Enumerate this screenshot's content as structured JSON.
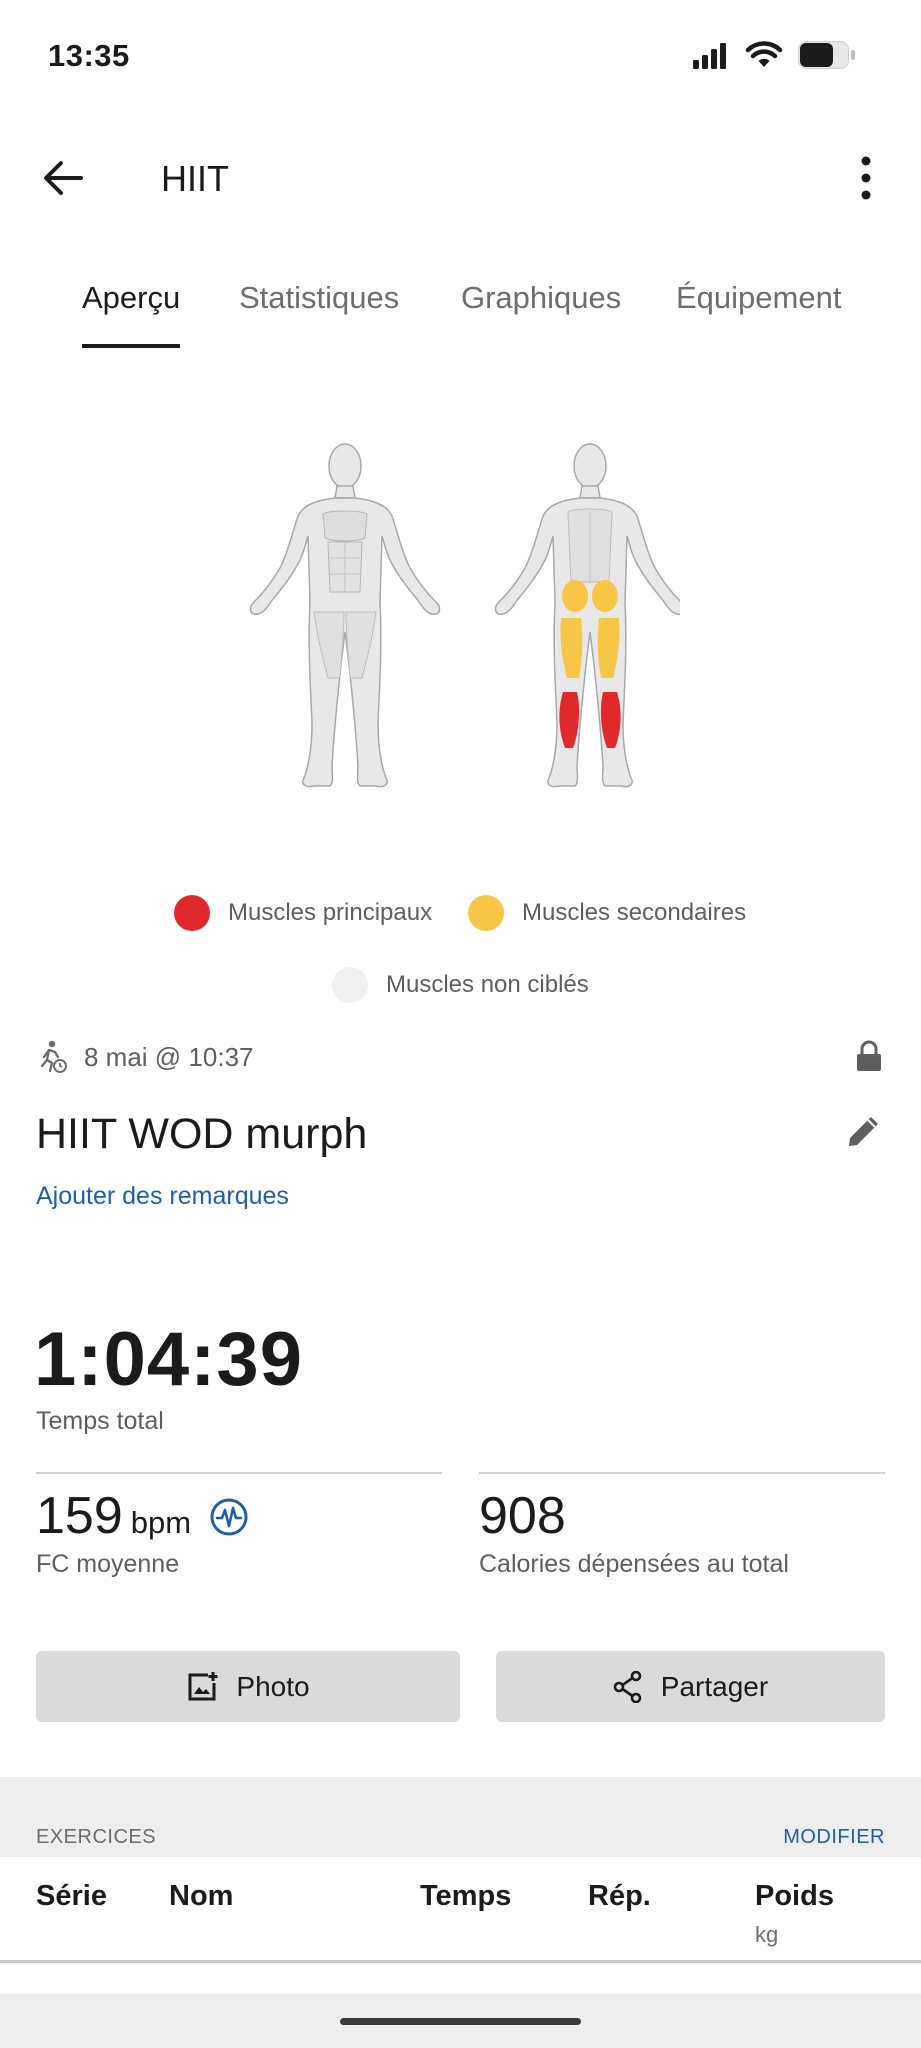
{
  "status_bar": {
    "time": "13:35"
  },
  "app_bar": {
    "title": "HIIT"
  },
  "tabs": [
    {
      "label": "Aperçu",
      "active": true
    },
    {
      "label": "Statistiques",
      "active": false
    },
    {
      "label": "Graphiques",
      "active": false
    },
    {
      "label": "Équipement",
      "active": false
    }
  ],
  "legend": {
    "primary": {
      "label": "Muscles principaux",
      "color": "#e1282d"
    },
    "secondary": {
      "label": "Muscles secondaires",
      "color": "#f8c646"
    },
    "untargeted": {
      "label": "Muscles non ciblés",
      "color": "#f0f0f0"
    }
  },
  "workout": {
    "date": "8 mai @ 10:37",
    "name": "HIIT WOD murph",
    "add_notes": "Ajouter des remarques",
    "total_time": "1:04:39",
    "total_time_label": "Temps total",
    "avg_hr": "159",
    "avg_hr_unit": "bpm",
    "avg_hr_label": "FC moyenne",
    "calories": "908",
    "calories_label": "Calories dépensées au total"
  },
  "actions": {
    "photo": "Photo",
    "share": "Partager"
  },
  "exercises": {
    "title": "EXERCICES",
    "edit": "MODIFIER",
    "columns": {
      "set": "Série",
      "name": "Nom",
      "time": "Temps",
      "reps": "Rép.",
      "weight": "Poids",
      "weight_unit": "kg"
    }
  },
  "colors": {
    "accent_blue": "#1f5fa8",
    "primary_muscle": "#e1282d",
    "secondary_muscle": "#f8c646"
  }
}
